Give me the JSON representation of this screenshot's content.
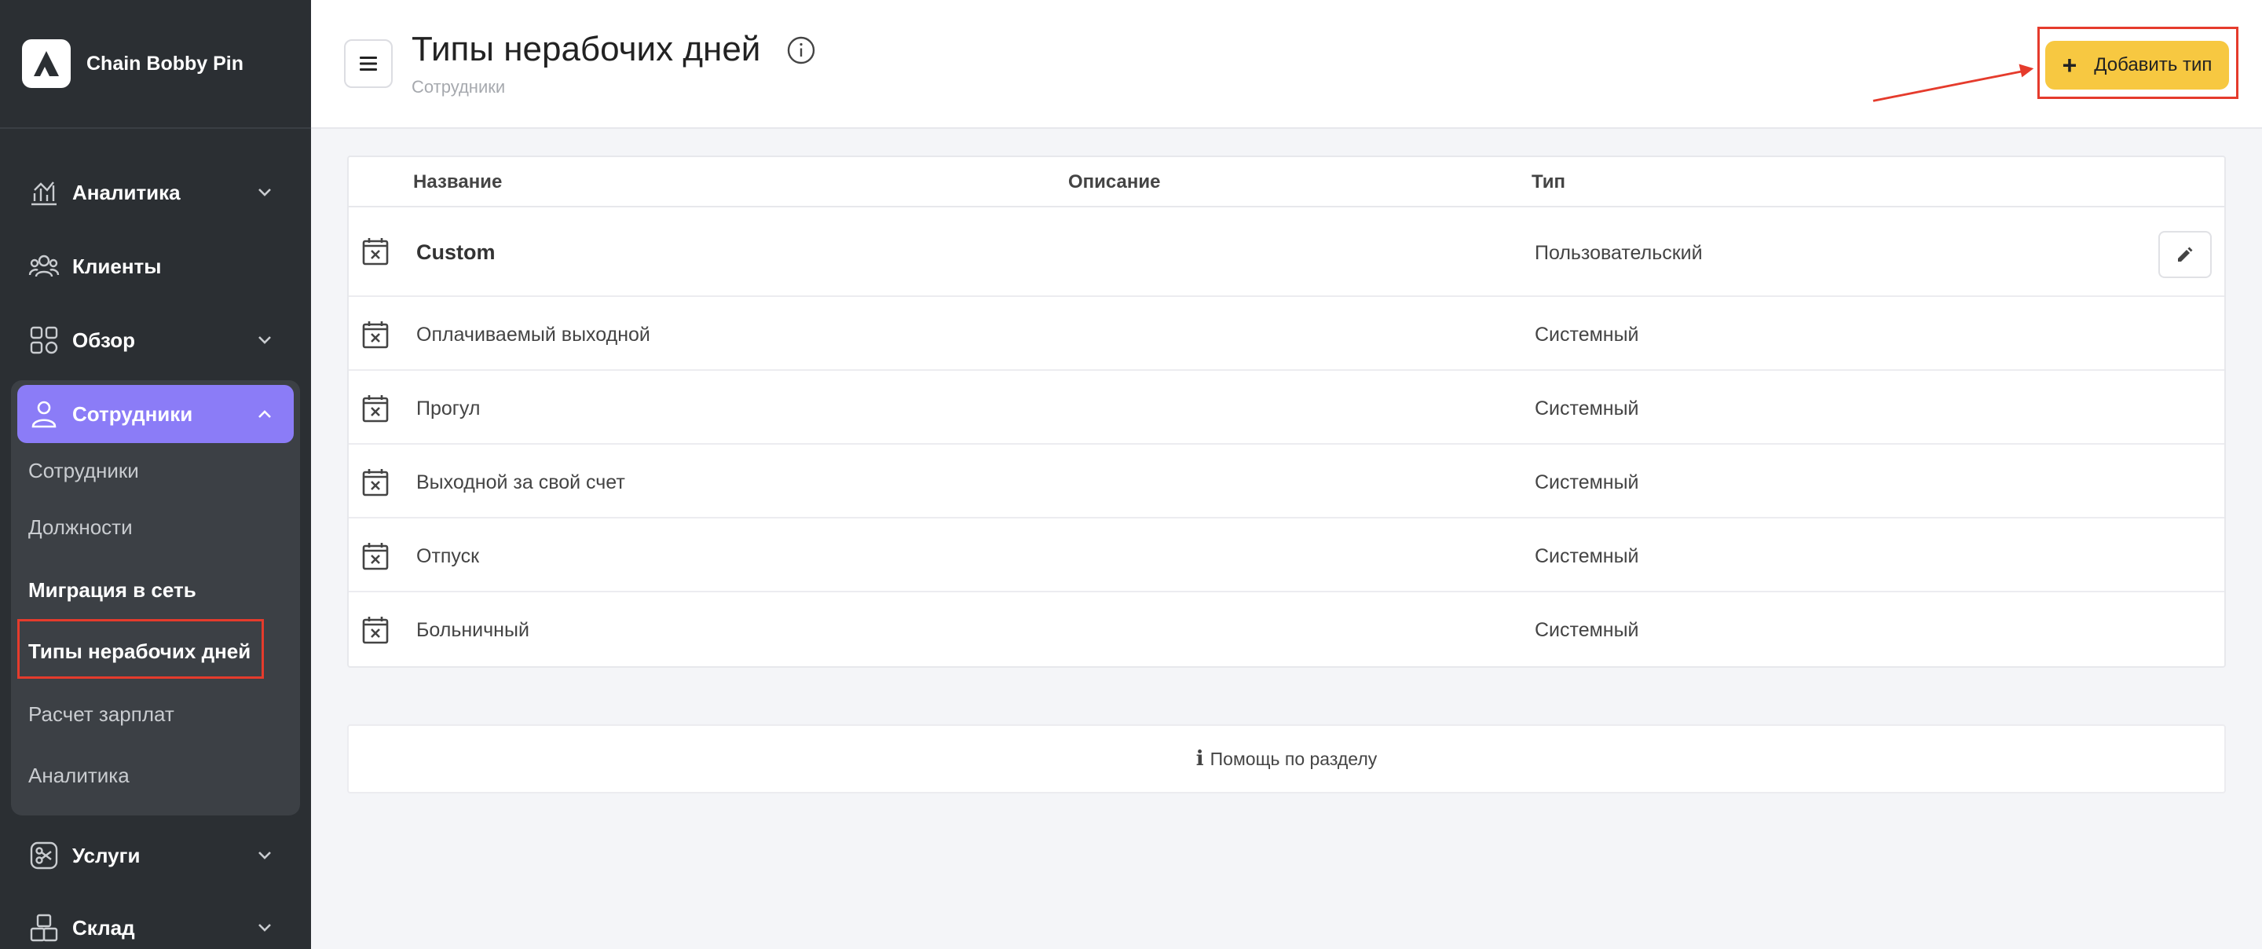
{
  "app": {
    "name": "Chain Bobby Pin"
  },
  "sidebar": {
    "items": [
      {
        "label": "Аналитика",
        "icon": "analytics-icon",
        "has_chevron": true
      },
      {
        "label": "Клиенты",
        "icon": "clients-icon",
        "has_chevron": false
      },
      {
        "label": "Обзор",
        "icon": "overview-grid-icon",
        "has_chevron": true
      },
      {
        "label": "Сотрудники",
        "icon": "user-icon",
        "active": true,
        "expanded": true
      },
      {
        "label": "Услуги",
        "icon": "scissors-icon",
        "has_chevron": true
      },
      {
        "label": "Склад",
        "icon": "boxes-icon",
        "has_chevron": true
      }
    ],
    "subitems": [
      {
        "label": "Сотрудники"
      },
      {
        "label": "Должности"
      },
      {
        "label": "Миграция в сеть"
      },
      {
        "label": "Типы нерабочих дней",
        "selected": true
      },
      {
        "label": "Расчет зарплат"
      },
      {
        "label": "Аналитика"
      }
    ]
  },
  "header": {
    "title": "Типы нерабочих дней",
    "breadcrumb": "Сотрудники",
    "add_button": "Добавить тип"
  },
  "table": {
    "columns": [
      "Название",
      "Описание",
      "Тип"
    ],
    "rows": [
      {
        "name": "Custom",
        "description": "",
        "type": "Пользовательский",
        "editable": true
      },
      {
        "name": "Оплачиваемый выходной",
        "description": "",
        "type": "Системный"
      },
      {
        "name": "Прогул",
        "description": "",
        "type": "Системный"
      },
      {
        "name": "Выходной за свой счет",
        "description": "",
        "type": "Системный"
      },
      {
        "name": "Отпуск",
        "description": "",
        "type": "Системный"
      },
      {
        "name": "Больничный",
        "description": "",
        "type": "Системный"
      }
    ]
  },
  "help": {
    "label": "Помощь по разделу"
  },
  "colors": {
    "sidebar_bg": "#2b2f33",
    "active_nav": "#8b7cf7",
    "accent_button": "#f7c841",
    "highlight_annotation": "#e53b2c"
  }
}
